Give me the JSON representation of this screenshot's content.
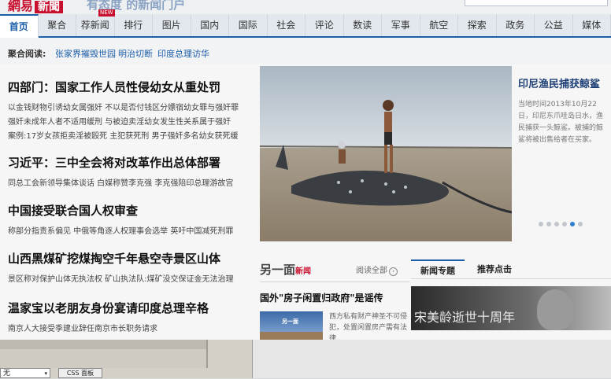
{
  "header": {
    "logo_text": "網易",
    "logo_badge": "新聞",
    "slogan": "有态度 的新闻门户"
  },
  "nav": {
    "tabs": [
      "首页",
      "聚合",
      "荐新闻",
      "排行",
      "图片",
      "国内",
      "国际",
      "社会",
      "评论",
      "数读",
      "军事",
      "航空",
      "探索",
      "政务",
      "公益",
      "媒体"
    ],
    "new_badge": "NEW"
  },
  "aggregate": {
    "label": "聚合阅读:",
    "links": [
      "张家界摧毁世园",
      "明治切断",
      "印度总理访华"
    ]
  },
  "headlines": [
    {
      "title": "四部门：国家工作人员性侵幼女从重处罚",
      "sub": [
        "以金钱财物引诱幼女属强奸 不以是否付钱区分嫖宿幼女罪与强奸罪",
        "强奸未成年人者不适用缓刑 与被迫卖淫幼女发生性关系属于强奸",
        "案例:17岁女孩拒卖淫被殴死 主犯获死刑 男子强奸多名幼女获死缓"
      ]
    },
    {
      "title": "习近平：三中全会将对改革作出总体部署",
      "sub": [
        "同总工会新领导集体谈话 白媒称赞李克强 李克强陪印总理游故宫"
      ]
    },
    {
      "title": "中国接受联合国人权审查",
      "sub": [
        "称部分指责系偏见 中俄等角逐人权理事会选举 英吁中国减死刑罪"
      ]
    },
    {
      "title": "山西黑煤矿挖煤掏空千年悬空寺景区山体",
      "sub": [
        "景区称对保护山体无执法权 矿山执法队:煤矿没交保证金无法治理"
      ]
    },
    {
      "title": "温家宝以老朋友身份宴请印度总理辛格",
      "sub": [
        "南京人大接受季建业辞任南京市长职务请求"
      ]
    }
  ],
  "feature": {
    "title": "印尼渔民捕获鲸鲨",
    "text": "当地时间2013年10月22日，印尼东爪哇岛日水，渔民捕获一头鲸鲨。被捕的鲸鲨将被出售给者在买家。"
  },
  "section2": {
    "brand": "另一面",
    "brand_mark": "新闻",
    "read_all": "阅读全部",
    "read_all_icon": "›",
    "title": "国外\"房子闲置归政府\"是谣传",
    "thumb_label": "另一面",
    "text": "西方私有财产神圣不可侵犯，处置闲置房产需有法律..."
  },
  "tabs2": {
    "tab1": "新闻专题",
    "tab2": "推荐点击",
    "banner_text": "宋美龄逝世十周年"
  },
  "bottom": {
    "select_value": "无",
    "select_arrow": "▾",
    "css_button": "CSS 面板"
  }
}
